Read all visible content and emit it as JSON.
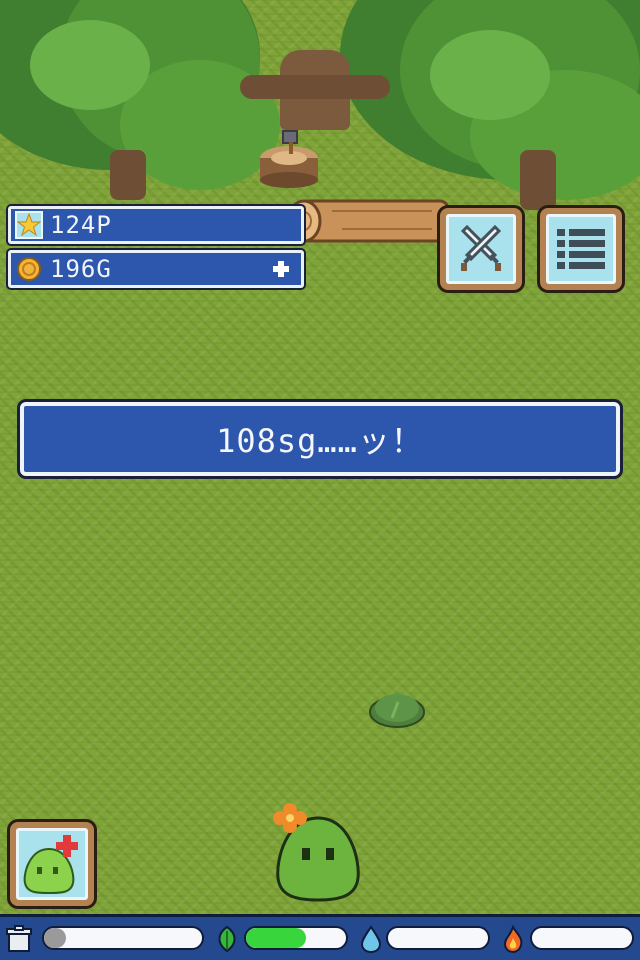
{
  "hud": {
    "points": "124P",
    "gold": "196G"
  },
  "message": "108sg……ッ！",
  "status_gauges": {
    "hunger": 0.14,
    "health": 0.6,
    "water": 0.0,
    "fire": 0.0
  },
  "colors": {
    "panel_blue": "#2d56ad",
    "panel_border": "#eef4f8",
    "grass": "#7fa437",
    "button_frame": "#b48250",
    "button_face": "#a9e1ec",
    "slime_green": "#6db43e",
    "flower_orange": "#f08a2a",
    "gauge_green": "#38d63c",
    "gauge_gray": "#9a9a9a"
  },
  "icons": {
    "points": "star-icon",
    "gold": "coin-icon",
    "add_gold": "plus-icon",
    "battle": "crossed-swords-icon",
    "menu": "list-icon",
    "care": "slime-heal-icon",
    "bottom_left": "trash-icon",
    "health": "leaf-icon",
    "water": "water-drop-icon",
    "fire": "flame-icon"
  }
}
